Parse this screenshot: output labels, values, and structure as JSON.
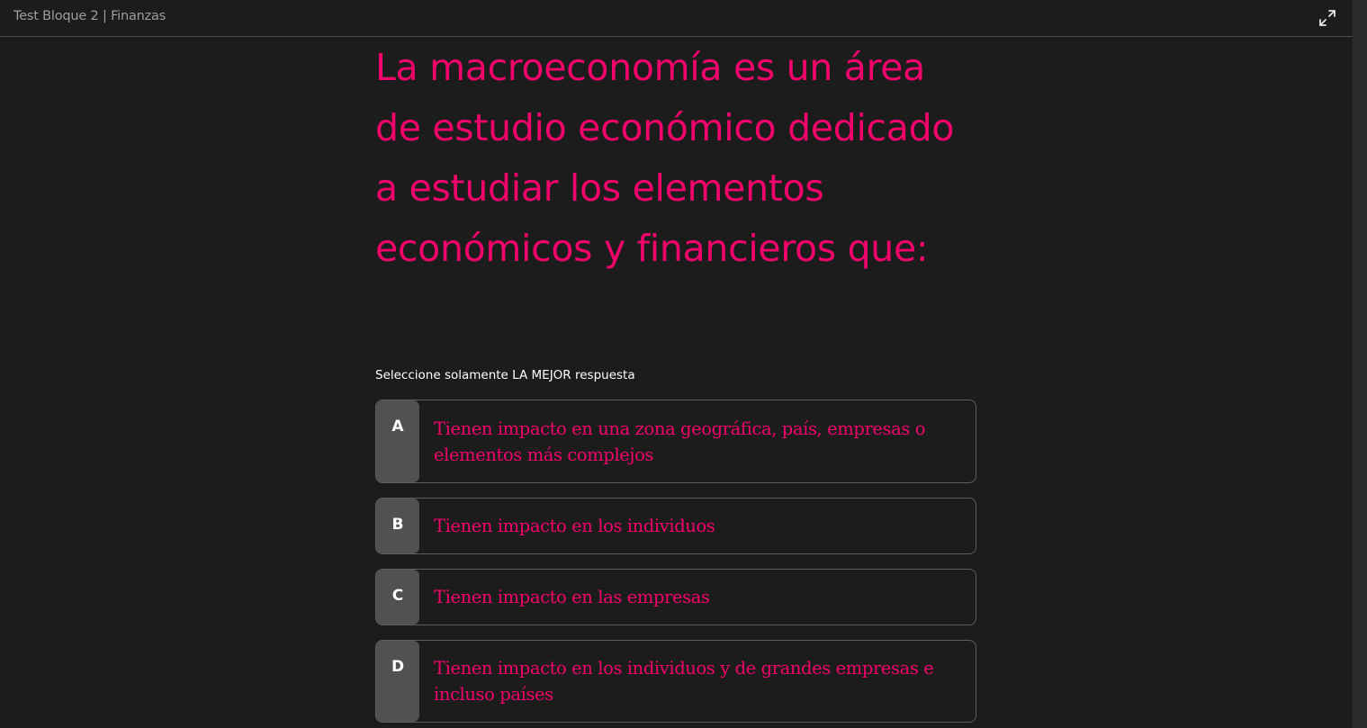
{
  "header": {
    "title": "Test Bloque 2 | Finanzas",
    "expand_icon": "expand-arrows-icon"
  },
  "question": {
    "text": "La macroeconomía es un área de estudio económico dedicado a estudiar los elementos económicos y financieros que:",
    "instruction": "Seleccione solamente LA MEJOR respuesta"
  },
  "options": [
    {
      "letter": "A",
      "text": "Tienen impacto en una zona geográfica, país, empresas o elementos más complejos"
    },
    {
      "letter": "B",
      "text": "Tienen impacto en los individuos"
    },
    {
      "letter": "C",
      "text": "Tienen impacto en las empresas"
    },
    {
      "letter": "D",
      "text": "Tienen impacto en los individuos y de grandes empresas e incluso países"
    }
  ],
  "colors": {
    "accent": "#f1056b",
    "background": "#1c1c1d",
    "letter_box": "#515151",
    "border": "#5e5e5e"
  }
}
